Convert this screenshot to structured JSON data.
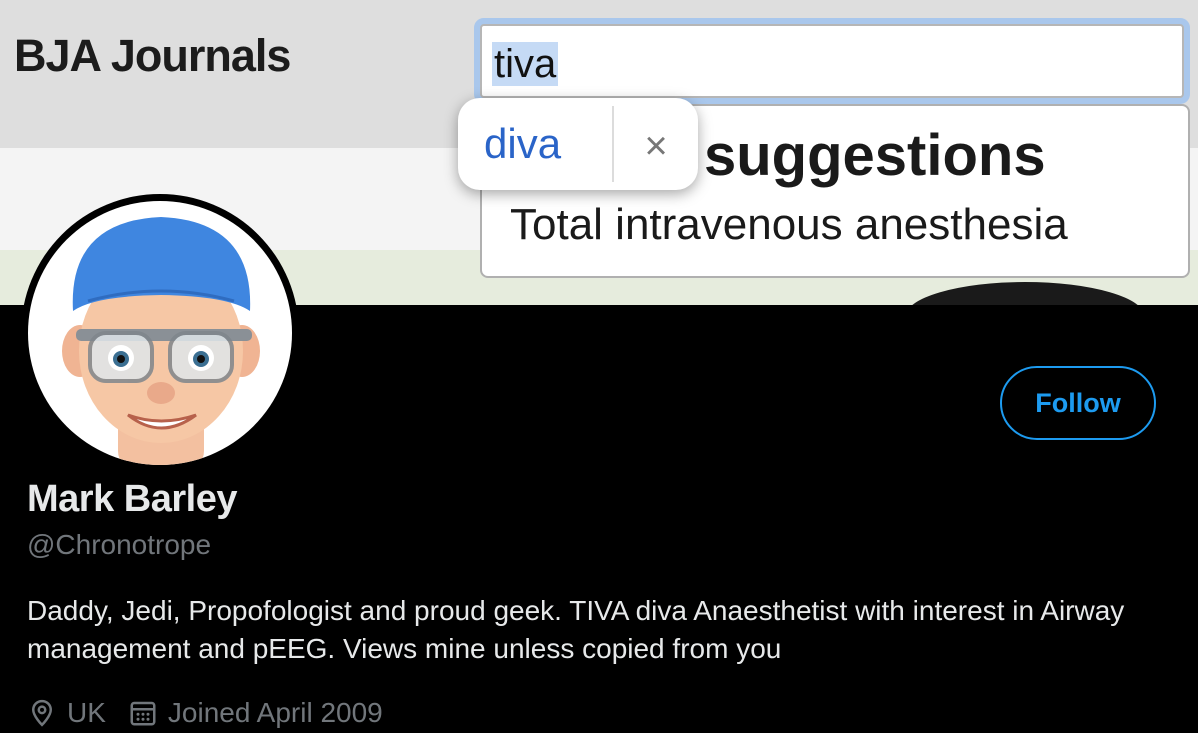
{
  "banner": {
    "brand_title": "BJA Journals",
    "search": {
      "value": "tiva"
    },
    "suggestions": {
      "heading_partial": "suggestions",
      "items": [
        "Total intravenous anesthesia"
      ]
    },
    "spell_popup": {
      "suggestion": "diva",
      "close_symbol": "×"
    }
  },
  "profile": {
    "display_name": "Mark Barley",
    "handle": "@Chronotrope",
    "bio": "Daddy, Jedi, Propofologist and proud geek. TIVA diva Anaesthetist with interest in Airway management and pEEG. Views mine unless copied from you",
    "location": "UK",
    "joined": "Joined April 2009",
    "follow_label": "Follow"
  },
  "colors": {
    "accent": "#1d9bf0",
    "background": "#000000",
    "primary_text": "#e7e9ea",
    "secondary_text": "#71767b",
    "link_suggestion": "#2a64c8"
  },
  "icons": {
    "location": "location-pin-icon",
    "joined": "calendar-icon",
    "close": "close-icon"
  }
}
